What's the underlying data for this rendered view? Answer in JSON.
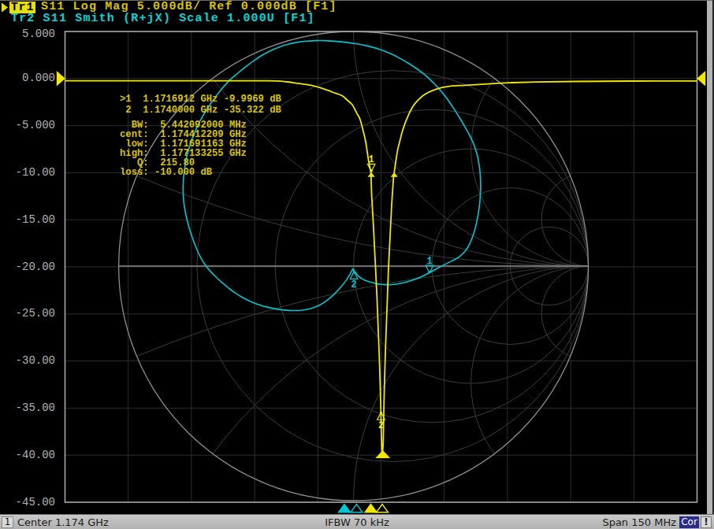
{
  "header": {
    "active_trace_marker": "arrow-right",
    "tr1": {
      "id": "Tr1",
      "text": "S11 Log Mag 5.000dB/ Ref 0.000dB [F1]",
      "active": true
    },
    "tr2": {
      "id": "Tr2",
      "text": " S11 Smith (R+jX) Scale 1.000U [F1]",
      "active": false
    }
  },
  "y_axis": {
    "labels": [
      "5.000",
      "0.000",
      "-5.000",
      "-10.00",
      "-15.00",
      "-20.00",
      "-25.00",
      "-30.00",
      "-35.00",
      "-40.00",
      "-45.00"
    ]
  },
  "readout": {
    "marker_lines": [
      ">1  1.1716912 GHz -9.9969 dB",
      " 2  1.1740000 GHz -35.322 dB"
    ],
    "bandwidth_lines": [
      "  BW:  5.442092000 MHz",
      "cent:  1.174412209 GHz",
      " low:  1.171691163 GHz",
      "high:  1.177133255 GHz",
      "   Q:  215.80",
      "loss: -10.000 dB"
    ]
  },
  "status_bar": {
    "channel": "1",
    "left": "Center 1.174 GHz",
    "center": "IFBW 70 kHz",
    "right": "Span 150 MHz",
    "cor_badge": "Cor",
    "warning_badge": "!"
  },
  "colors": {
    "trace1": "#f0e800",
    "trace2": "#00c6d2",
    "text_yellow": "#d8c300",
    "text_cyan": "#00d6d6",
    "chip_bg": "#e8e000",
    "axis_label": "#b2b2b2",
    "grid": "#2d2d2d",
    "smith_grid": "#3c3c3c",
    "smith_axis": "#8e8e8e",
    "plot_border": "#a8a8a8",
    "cor_bg": "#2b2b8c"
  },
  "chart_data": [
    {
      "type": "line",
      "name": "Tr1 S11 Log Mag",
      "format": "log_mag_db",
      "scale_db_per_div": 5.0,
      "ref_level_db": 0.0,
      "x_unit": "GHz",
      "x_range": [
        1.099,
        1.249
      ],
      "y_range": [
        -45,
        5
      ],
      "grid_divisions": [
        10,
        10
      ],
      "points": [
        [
          1.099,
          -0.242
        ],
        [
          1.120976,
          -0.242
        ],
        [
          1.14342,
          -0.242
        ],
        [
          1.149031,
          -0.251
        ],
        [
          1.151837,
          -0.351
        ],
        [
          1.154642,
          -0.535
        ],
        [
          1.157448,
          -0.719
        ],
        [
          1.160253,
          -1.079
        ],
        [
          1.163059,
          -1.538
        ],
        [
          1.164742,
          -1.814
        ],
        [
          1.166051,
          -2.316
        ],
        [
          1.167173,
          -2.776
        ],
        [
          1.168202,
          -3.637
        ],
        [
          1.169044,
          -4.365
        ],
        [
          1.169792,
          -5.619
        ],
        [
          1.170353,
          -6.706
        ],
        [
          1.170727,
          -7.793
        ],
        [
          1.171007,
          -8.629
        ],
        [
          1.171569,
          -10.0
        ],
        [
          1.171793,
          -12.559
        ],
        [
          1.172223,
          -15.903
        ],
        [
          1.172597,
          -19.247
        ],
        [
          1.172971,
          -22.592
        ],
        [
          1.173345,
          -26.773
        ],
        [
          1.173663,
          -30.535
        ],
        [
          1.173906,
          -34.298
        ],
        [
          1.174094,
          -38.06
        ],
        [
          1.174262,
          -39.816
        ],
        [
          1.174524,
          -38.478
        ],
        [
          1.174711,
          -34.298
        ],
        [
          1.174935,
          -30.535
        ],
        [
          1.175216,
          -26.773
        ],
        [
          1.175496,
          -23.428
        ],
        [
          1.175777,
          -20.084
        ],
        [
          1.176151,
          -16.739
        ],
        [
          1.176525,
          -13.395
        ],
        [
          1.176899,
          -10.886
        ],
        [
          1.177123,
          -10.0
        ],
        [
          1.177647,
          -8.378
        ],
        [
          1.177984,
          -7.483
        ],
        [
          1.178489,
          -6.589
        ],
        [
          1.178994,
          -5.694
        ],
        [
          1.179667,
          -4.791
        ],
        [
          1.18049,
          -3.896
        ],
        [
          1.1815,
          -3.002
        ],
        [
          1.182828,
          -2.258
        ],
        [
          1.184493,
          -1.656
        ],
        [
          1.186512,
          -1.212
        ],
        [
          1.188514,
          -0.945
        ],
        [
          1.190515,
          -0.794
        ],
        [
          1.193919,
          -0.711
        ],
        [
          1.198595,
          -0.585
        ],
        [
          1.204206,
          -0.452
        ],
        [
          1.210752,
          -0.368
        ],
        [
          1.220103,
          -0.309
        ],
        [
          1.233196,
          -0.268
        ],
        [
          1.249,
          -0.259
        ]
      ],
      "markers": [
        {
          "n": "1",
          "freq_ghz": 1.1716912,
          "value_db": -9.9969,
          "active": true,
          "flip": false
        },
        {
          "n": "2",
          "freq_ghz": 1.174,
          "value_db": -35.322,
          "active": false,
          "flip": true
        }
      ],
      "bandwidth_search": {
        "bw_mhz": 5.442092,
        "center_ghz": 1.174412209,
        "low_ghz": 1.171691163,
        "high_ghz": 1.177133255,
        "q": 215.8,
        "loss_db": -10.0
      }
    },
    {
      "type": "smith",
      "name": "Tr2 S11 Smith (R+jX)",
      "scale": 1.0,
      "grid": {
        "resistance_circles": [
          0.2,
          0.5,
          1,
          2,
          5
        ],
        "reactance_arcs": [
          0.2,
          0.5,
          1,
          2,
          5
        ]
      },
      "gamma_points": [
        [
          -0.002,
          -0.0101
        ],
        [
          0.005,
          -0.023
        ],
        [
          0.0134,
          -0.0352
        ],
        [
          0.0241,
          -0.0461
        ],
        [
          0.0376,
          -0.0552
        ],
        [
          0.0532,
          -0.0624
        ],
        [
          0.0705,
          -0.0682
        ],
        [
          0.0891,
          -0.0729
        ],
        [
          0.1097,
          -0.0768
        ],
        [
          0.1344,
          -0.0794
        ],
        [
          0.1656,
          -0.0787
        ],
        [
          0.2044,
          -0.0729
        ],
        [
          0.2474,
          -0.0614
        ],
        [
          0.289,
          -0.0454
        ],
        [
          0.326,
          -0.027
        ],
        [
          0.3592,
          -0.0084
        ],
        [
          0.3907,
          0.0082
        ],
        [
          0.4213,
          0.023
        ],
        [
          0.4497,
          0.0394
        ],
        [
          0.474,
          0.0621
        ],
        [
          0.4936,
          0.0929
        ],
        [
          0.5089,
          0.1304
        ],
        [
          0.5209,
          0.1721
        ],
        [
          0.5299,
          0.2156
        ],
        [
          0.5363,
          0.2594
        ],
        [
          0.5401,
          0.3027
        ],
        [
          0.5413,
          0.3459
        ],
        [
          0.5395,
          0.39
        ],
        [
          0.5343,
          0.4354
        ],
        [
          0.5247,
          0.4805
        ],
        [
          0.5103,
          0.523
        ],
        [
          0.492,
          0.5622
        ],
        [
          0.4712,
          0.5991
        ],
        [
          0.4498,
          0.635
        ],
        [
          0.4285,
          0.6692
        ],
        [
          0.4075,
          0.7007
        ],
        [
          0.3865,
          0.7289
        ],
        [
          0.3655,
          0.754
        ],
        [
          0.3445,
          0.7767
        ],
        [
          0.3227,
          0.7981
        ],
        [
          0.2987,
          0.8191
        ],
        [
          0.2701,
          0.8406
        ],
        [
          0.2358,
          0.8632
        ],
        [
          0.1968,
          0.8858
        ],
        [
          0.1547,
          0.9066
        ],
        [
          0.1092,
          0.9243
        ],
        [
          0.0587,
          0.9383
        ],
        [
          0.0034,
          0.9488
        ],
        [
          -0.0533,
          0.956
        ],
        [
          -0.1072,
          0.9602
        ],
        [
          -0.1567,
          0.9612
        ],
        [
          -0.202,
          0.9589
        ],
        [
          -0.2437,
          0.9533
        ],
        [
          -0.2828,
          0.9444
        ],
        [
          -0.3203,
          0.932
        ],
        [
          -0.3571,
          0.9161
        ],
        [
          -0.3926,
          0.8967
        ],
        [
          -0.4253,
          0.875
        ],
        [
          -0.4542,
          0.8532
        ],
        [
          -0.4795,
          0.8331
        ],
        [
          -0.5028,
          0.814
        ],
        [
          -0.5254,
          0.7941
        ],
        [
          -0.5468,
          0.7722
        ],
        [
          -0.5669,
          0.7483
        ],
        [
          -0.5873,
          0.7216
        ],
        [
          -0.6097,
          0.6902
        ],
        [
          -0.6331,
          0.6543
        ],
        [
          -0.6548,
          0.616
        ],
        [
          -0.6731,
          0.5774
        ],
        [
          -0.6883,
          0.5393
        ],
        [
          -0.7008,
          0.5017
        ],
        [
          -0.7106,
          0.4648
        ],
        [
          -0.7176,
          0.4284
        ],
        [
          -0.7225,
          0.3919
        ],
        [
          -0.7253,
          0.3548
        ],
        [
          -0.7259,
          0.317
        ],
        [
          -0.7235,
          0.2787
        ],
        [
          -0.7179,
          0.2395
        ],
        [
          -0.7093,
          0.1987
        ],
        [
          -0.6979,
          0.1568
        ],
        [
          -0.6845,
          0.1154
        ],
        [
          -0.6696,
          0.0762
        ],
        [
          -0.6527,
          0.0399
        ],
        [
          -0.6331,
          0.0073
        ],
        [
          -0.6104,
          -0.0214
        ],
        [
          -0.5854,
          -0.0471
        ],
        [
          -0.559,
          -0.0711
        ],
        [
          -0.5318,
          -0.0938
        ],
        [
          -0.5039,
          -0.1143
        ],
        [
          -0.475,
          -0.1324
        ],
        [
          -0.444,
          -0.1484
        ],
        [
          -0.4092,
          -0.1627
        ],
        [
          -0.369,
          -0.1749
        ],
        [
          -0.3231,
          -0.1842
        ],
        [
          -0.2736,
          -0.1893
        ],
        [
          -0.2242,
          -0.1885
        ],
        [
          -0.1793,
          -0.1803
        ],
        [
          -0.1407,
          -0.1644
        ],
        [
          -0.1077,
          -0.1422
        ],
        [
          -0.0787,
          -0.1162
        ],
        [
          -0.0531,
          -0.0884
        ],
        [
          -0.0317,
          -0.0607
        ],
        [
          -0.0152,
          -0.0346
        ],
        [
          -0.002,
          -0.0101
        ]
      ],
      "markers": [
        {
          "n": "1",
          "gamma": [
            0.3235,
            -0.0339
          ],
          "flip": false
        },
        {
          "n": "2",
          "gamma": [
            0.002,
            -0.0181
          ],
          "flip": true
        }
      ]
    }
  ],
  "stimulus_markers": [
    {
      "trace": 2,
      "n": "1",
      "x": 437.0,
      "filled": true,
      "color": "trace2"
    },
    {
      "trace": 2,
      "n": "2",
      "x": 452.5,
      "filled": false,
      "color": "trace2"
    },
    {
      "trace": 1,
      "n": "1",
      "x": 470.5,
      "filled": true,
      "color": "trace1"
    },
    {
      "trace": 1,
      "n": "2",
      "x": 485.0,
      "filled": false,
      "color": "trace1"
    }
  ]
}
